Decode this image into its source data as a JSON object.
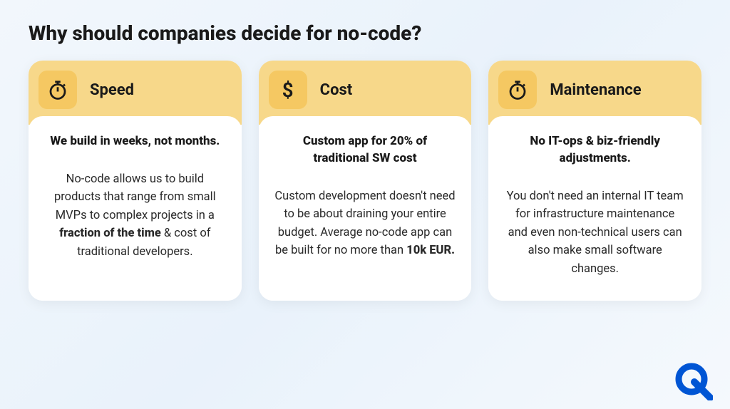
{
  "title": "Why should companies decide for no-code?",
  "cards": [
    {
      "icon": "stopwatch",
      "title": "Speed",
      "headline": "We build in weeks, not months.",
      "desc_html": "No-code allows us to build products that range from small MVPs to complex projects in a <b>fraction of the time</b> & cost of traditional developers."
    },
    {
      "icon": "dollar",
      "title": "Cost",
      "headline": "Custom app for 20% of traditional SW cost",
      "desc_html": "Custom development doesn't need to be about draining your entire budget. Average no-code app can be built for no more than <b>10k EUR.</b>"
    },
    {
      "icon": "stopwatch",
      "title": "Maintenance",
      "headline": "No IT-ops & biz-friendly adjustments.",
      "desc_html": "You don't need an internal IT team for infrastructure maintenance and even non-technical users can also make small software changes."
    }
  ]
}
